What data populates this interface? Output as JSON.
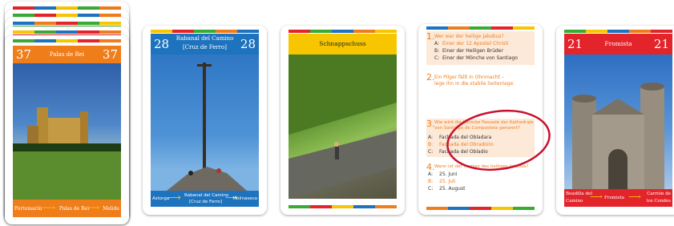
{
  "stack_card": {
    "number": "37",
    "title": "Palas de Rei",
    "route": [
      "Portomarín",
      "Palas de Rei",
      "Melide"
    ]
  },
  "card_cruz": {
    "number": "28",
    "title_line1": "Rabanal del Camino",
    "title_line2": "[Cruz de Ferro]",
    "route_left": "Astorga",
    "route_mid_line1": "Rabanal del Camino",
    "route_mid_line2": "[Cruz de Ferro]",
    "route_right": "Molinaseca"
  },
  "card_schnapps": {
    "title": "Schnappschuss"
  },
  "quiz_card": {
    "q1": {
      "num": "1.",
      "text": "Wer war der heilige Jakobus?",
      "answers": [
        {
          "letter": "A:",
          "text": "Einer der 12 Apostel Christi"
        },
        {
          "letter": "B:",
          "text": "Einer der Heiligen Brüder"
        },
        {
          "letter": "C:",
          "text": "Einer der Mönche von Santiago"
        }
      ]
    },
    "q2": {
      "num": "2.",
      "line1": "Ein Pilger fällt in Ohnmacht –",
      "line2": "lege ihn in die stabile Seitenlage."
    },
    "q3": {
      "num": "3.",
      "line1": "Wie wird die barocke Fassade der Kathedrale",
      "line2": "von Santiago de Compostela genannt?",
      "answers": [
        {
          "letter": "A:",
          "text": "Fachada del Obladara"
        },
        {
          "letter": "B:",
          "text": "Fachada del Obradoiro"
        },
        {
          "letter": "C:",
          "text": "Fachada del Obladio"
        }
      ]
    },
    "q4": {
      "num": "4.",
      "text": "Wann ist der Festtag des heiligen Jakobus?",
      "answers": [
        {
          "letter": "A:",
          "text": "25. Juni"
        },
        {
          "letter": "B:",
          "text": "25. Juli"
        },
        {
          "letter": "C:",
          "text": "25. August"
        }
      ]
    }
  },
  "card_fromista": {
    "number": "21",
    "title": "Fromista",
    "route_left_line1": "Boadilla del",
    "route_left_line2": "Camino",
    "route_mid": "Fromista",
    "route_right_line1": "Carrión de",
    "route_right_line2": "los Condes"
  },
  "colors": {
    "orange": "#ef7d1a",
    "blue": "#1e73be",
    "yellow": "#f7c600",
    "red": "#e3242b",
    "highlight_ring": "#c8102e"
  }
}
